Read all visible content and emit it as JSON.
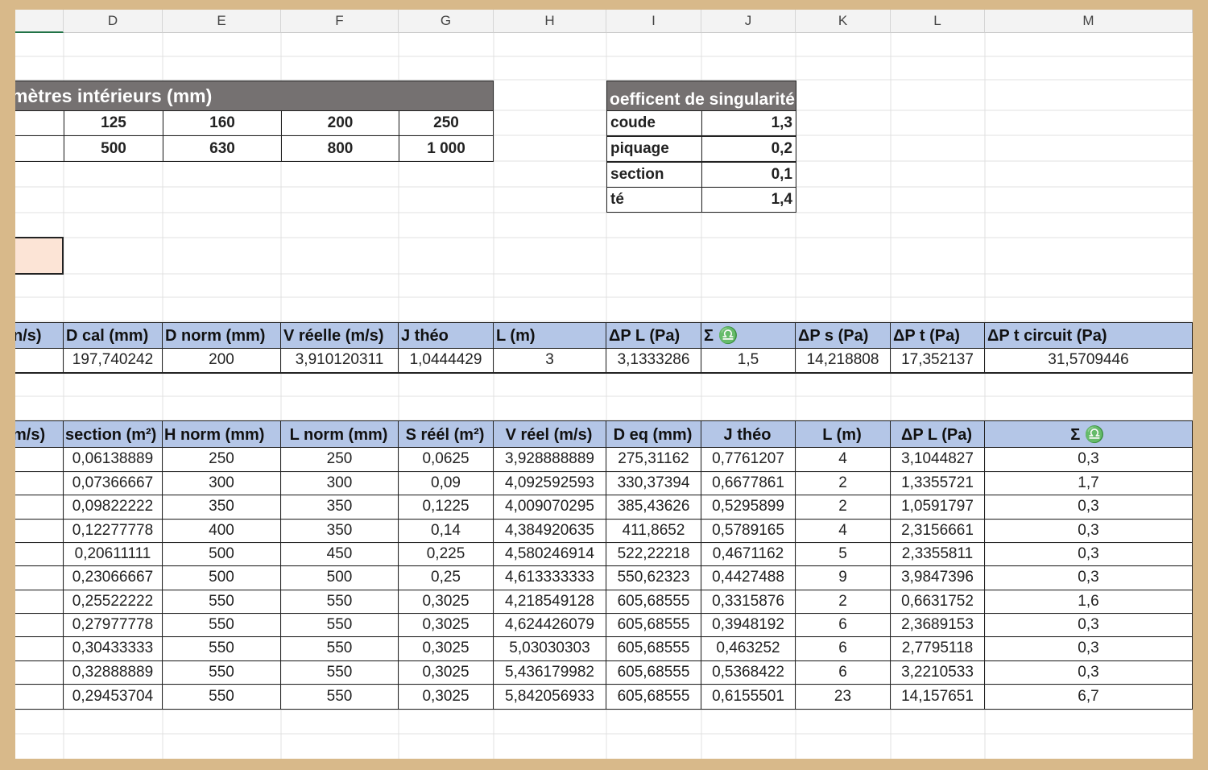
{
  "columns": [
    "D",
    "E",
    "F",
    "G",
    "H",
    "I",
    "J",
    "K",
    "L",
    "M"
  ],
  "diam": {
    "title": "mètres intérieurs (mm)",
    "row1": [
      "125",
      "160",
      "200",
      "250"
    ],
    "row2": [
      "500",
      "630",
      "800",
      "1 000"
    ]
  },
  "sing": {
    "title": "oefficent de singularité",
    "rows": [
      {
        "label": "coude",
        "value": "1,3"
      },
      {
        "label": "piquage",
        "value": "0,2"
      },
      {
        "label": "section",
        "value": "0,1"
      },
      {
        "label": "té",
        "value": "1,4"
      }
    ]
  },
  "accent_colors": {
    "header_dark": "#757171",
    "header_blue": "#b4c6e7",
    "input_cell": "#fce4d6",
    "frame": "#d8b98a"
  },
  "table1": {
    "headers": [
      "n/s)",
      "D cal (mm)",
      "D norm (mm)",
      "V réelle (m/s)",
      "J théo",
      "L (m)",
      "ΔP L (Pa)",
      "Σ ♎",
      "ΔP s (Pa)",
      "ΔP t (Pa)",
      "ΔP t circuit (Pa)"
    ],
    "row": [
      "",
      "197,740242",
      "200",
      "3,910120311",
      "1,0444429",
      "3",
      "3,1333286",
      "1,5",
      "14,218808",
      "17,352137",
      "31,5709446"
    ]
  },
  "table2": {
    "headers": [
      "m/s)",
      "section (m²)",
      "H norm (mm)",
      "L norm (mm)",
      "S réél (m²)",
      "V réel (m/s)",
      "D eq (mm)",
      "J théo",
      "L (m)",
      "ΔP L (Pa)",
      "Σ ♎"
    ],
    "rows": [
      [
        "",
        "0,06138889",
        "250",
        "250",
        "0,0625",
        "3,928888889",
        "275,31162",
        "0,7761207",
        "4",
        "3,1044827",
        "0,3"
      ],
      [
        "",
        "0,07366667",
        "300",
        "300",
        "0,09",
        "4,092592593",
        "330,37394",
        "0,6677861",
        "2",
        "1,3355721",
        "1,7"
      ],
      [
        "",
        "0,09822222",
        "350",
        "350",
        "0,1225",
        "4,009070295",
        "385,43626",
        "0,5295899",
        "2",
        "1,0591797",
        "0,3"
      ],
      [
        "",
        "0,12277778",
        "400",
        "350",
        "0,14",
        "4,384920635",
        "411,8652",
        "0,5789165",
        "4",
        "2,3156661",
        "0,3"
      ],
      [
        "",
        "0,20611111",
        "500",
        "450",
        "0,225",
        "4,580246914",
        "522,22218",
        "0,4671162",
        "5",
        "2,3355811",
        "0,3"
      ],
      [
        "",
        "0,23066667",
        "500",
        "500",
        "0,25",
        "4,613333333",
        "550,62323",
        "0,4427488",
        "9",
        "3,9847396",
        "0,3"
      ],
      [
        "",
        "0,25522222",
        "550",
        "550",
        "0,3025",
        "4,218549128",
        "605,68555",
        "0,3315876",
        "2",
        "0,6631752",
        "1,6"
      ],
      [
        "",
        "0,27977778",
        "550",
        "550",
        "0,3025",
        "4,624426079",
        "605,68555",
        "0,3948192",
        "6",
        "2,3689153",
        "0,3"
      ],
      [
        "",
        "0,30433333",
        "550",
        "550",
        "0,3025",
        "5,03030303",
        "605,68555",
        "0,463252",
        "6",
        "2,7795118",
        "0,3"
      ],
      [
        "",
        "0,32888889",
        "550",
        "550",
        "0,3025",
        "5,436179982",
        "605,68555",
        "0,5368422",
        "6",
        "3,2210533",
        "0,3"
      ],
      [
        "",
        "0,29453704",
        "550",
        "550",
        "0,3025",
        "5,842056933",
        "605,68555",
        "0,6155501",
        "23",
        "14,157651",
        "6,7"
      ]
    ]
  }
}
